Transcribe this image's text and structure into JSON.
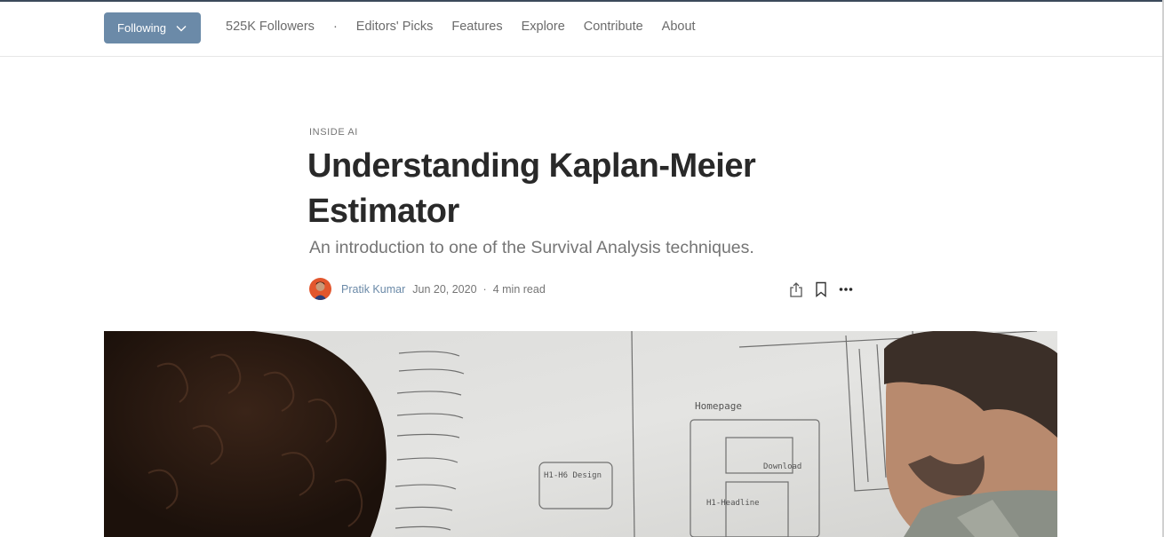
{
  "nav": {
    "follow_label": "Following",
    "followers": "525K Followers",
    "dot": "·",
    "links": [
      "Editors' Picks",
      "Features",
      "Explore",
      "Contribute",
      "About"
    ]
  },
  "article": {
    "kicker": "INSIDE AI",
    "title": "Understanding Kaplan-Meier Estimator",
    "subtitle": "An introduction to one of the Survival Analysis techniques.",
    "author": "Pratik Kumar",
    "date": "Jun 20, 2020",
    "separator": "·",
    "read_time": "4 min read"
  },
  "whiteboard": {
    "label_1": "Homepage",
    "label_2": "H1-H6 Design",
    "label_3": "Download",
    "label_4": "H1-Headline"
  },
  "icons": {
    "follow": "chevron-down-icon",
    "share": "share-icon",
    "bookmark": "bookmark-icon",
    "more": "more-icon"
  },
  "colors": {
    "accent": "#6b8aa8",
    "text": "#292929",
    "muted": "#757575"
  }
}
